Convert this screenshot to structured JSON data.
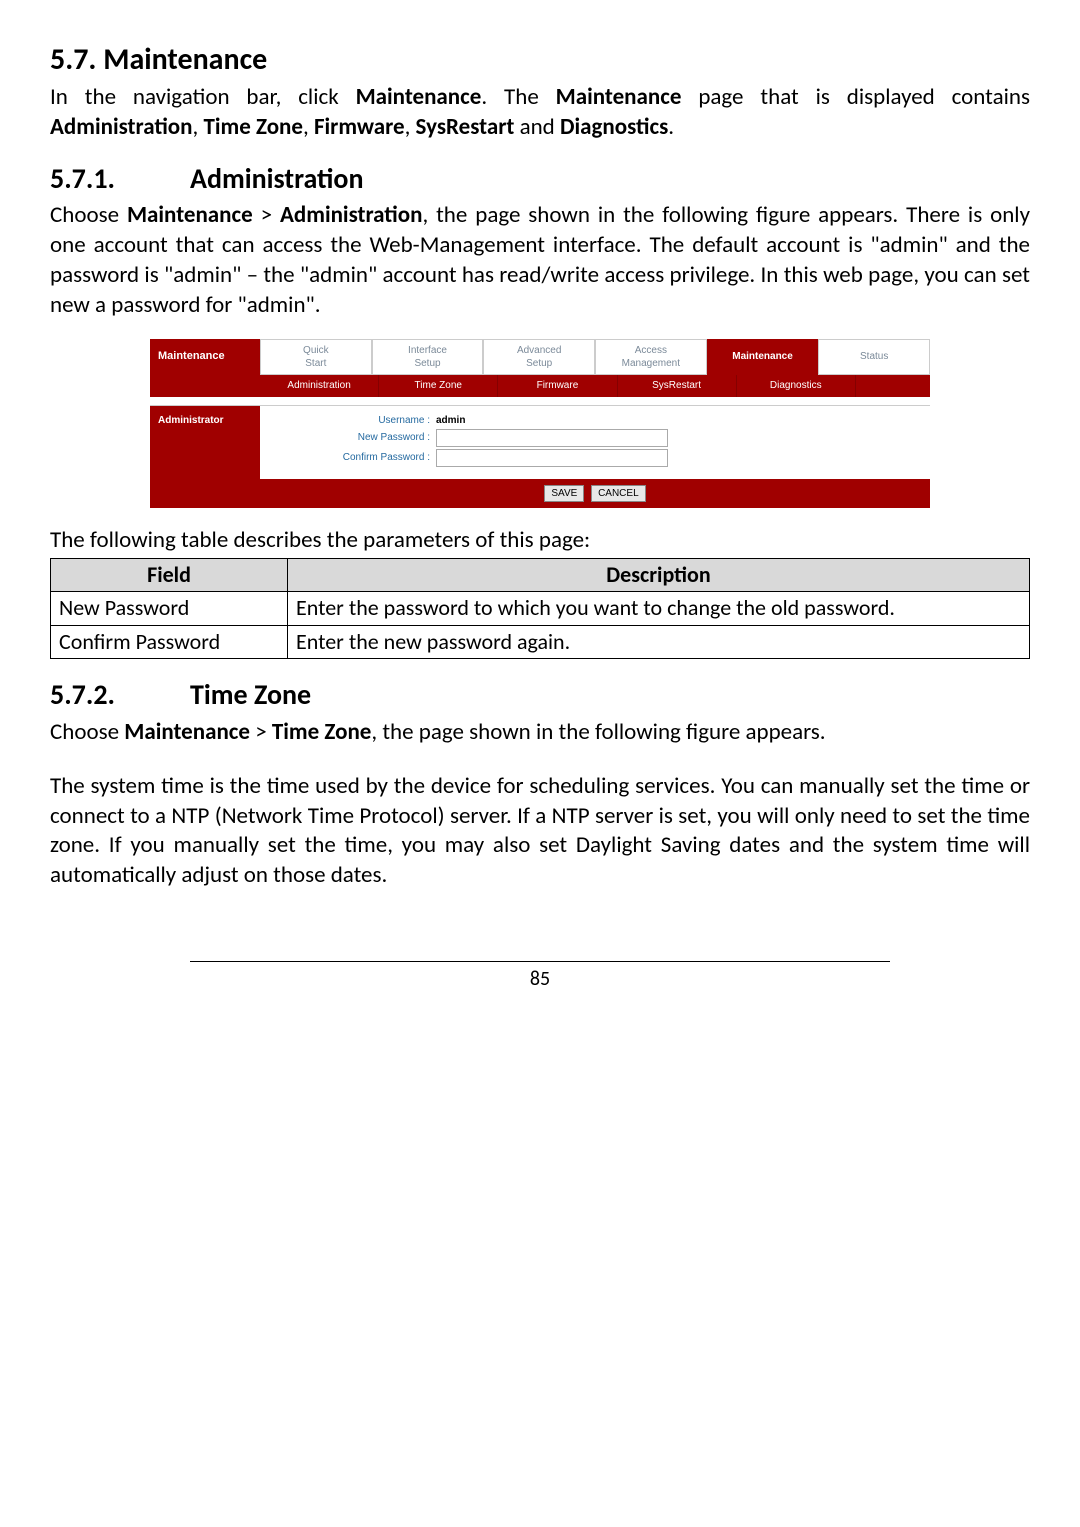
{
  "section": {
    "h2": "5.7. Maintenance",
    "p1_pre": "In the navigation bar, click ",
    "p1_b1": "Maintenance",
    "p1_mid1": ". The ",
    "p1_b2": "Maintenance",
    "p1_mid2": " page that is displayed contains ",
    "p1_b3": "Administration",
    "p1_sep1": ", ",
    "p1_b4": "Time Zone",
    "p1_sep2": ", ",
    "p1_b5": "Firmware",
    "p1_sep3": ", ",
    "p1_b6": "SysRestart",
    "p1_sep4": " and ",
    "p1_b7": "Diagnostics",
    "p1_end": "."
  },
  "s571": {
    "num": "5.7.1.",
    "title": "Administration",
    "p1_pre": "Choose ",
    "p1_b1": "Maintenance",
    "p1_gt": " > ",
    "p1_b2": "Administration",
    "p1_rest": ", the page shown in the following figure appears. There is only one account that can access the Web-Management interface. The default account is \"admin\" and the password is \"admin\" – the \"admin\" account has read/write access privilege. In this web page, you can set new a password for \"admin\"."
  },
  "ui": {
    "side_title": "Maintenance",
    "tabs": [
      "Quick\nStart",
      "Interface\nSetup",
      "Advanced\nSetup",
      "Access\nManagement",
      "Maintenance",
      "Status"
    ],
    "subtabs": [
      "Administration",
      "Time Zone",
      "Firmware",
      "SysRestart",
      "Diagnostics",
      ""
    ],
    "admin_label": "Administrator",
    "form": {
      "username_label": "Username :",
      "username_value": "admin",
      "newpw_label": "New Password :",
      "confpw_label": "Confirm Password :"
    },
    "btn_save": "SAVE",
    "btn_cancel": "CANCEL"
  },
  "table_caption": "The following table describes the parameters of this page:",
  "table": {
    "h_field": "Field",
    "h_desc": "Description",
    "rows": [
      {
        "f": "New Password",
        "d": "Enter the password to which you want to change the old password."
      },
      {
        "f": "Confirm Password",
        "d": "Enter the new password again."
      }
    ]
  },
  "s572": {
    "num": "5.7.2.",
    "title": "Time Zone",
    "p1_pre": "Choose ",
    "p1_b1": "Maintenance",
    "p1_gt": " > ",
    "p1_b2": "Time Zone",
    "p1_rest": ", the page shown in the following figure appears.",
    "p2": "The system time is the time used by the device for scheduling services. You can manually set the time or connect to a NTP (Network Time Protocol) server. If a NTP server is set, you will only need to set the time zone. If you manually set the time, you may also set Daylight Saving dates and the system time will automatically adjust on those dates."
  },
  "page_num": "85"
}
